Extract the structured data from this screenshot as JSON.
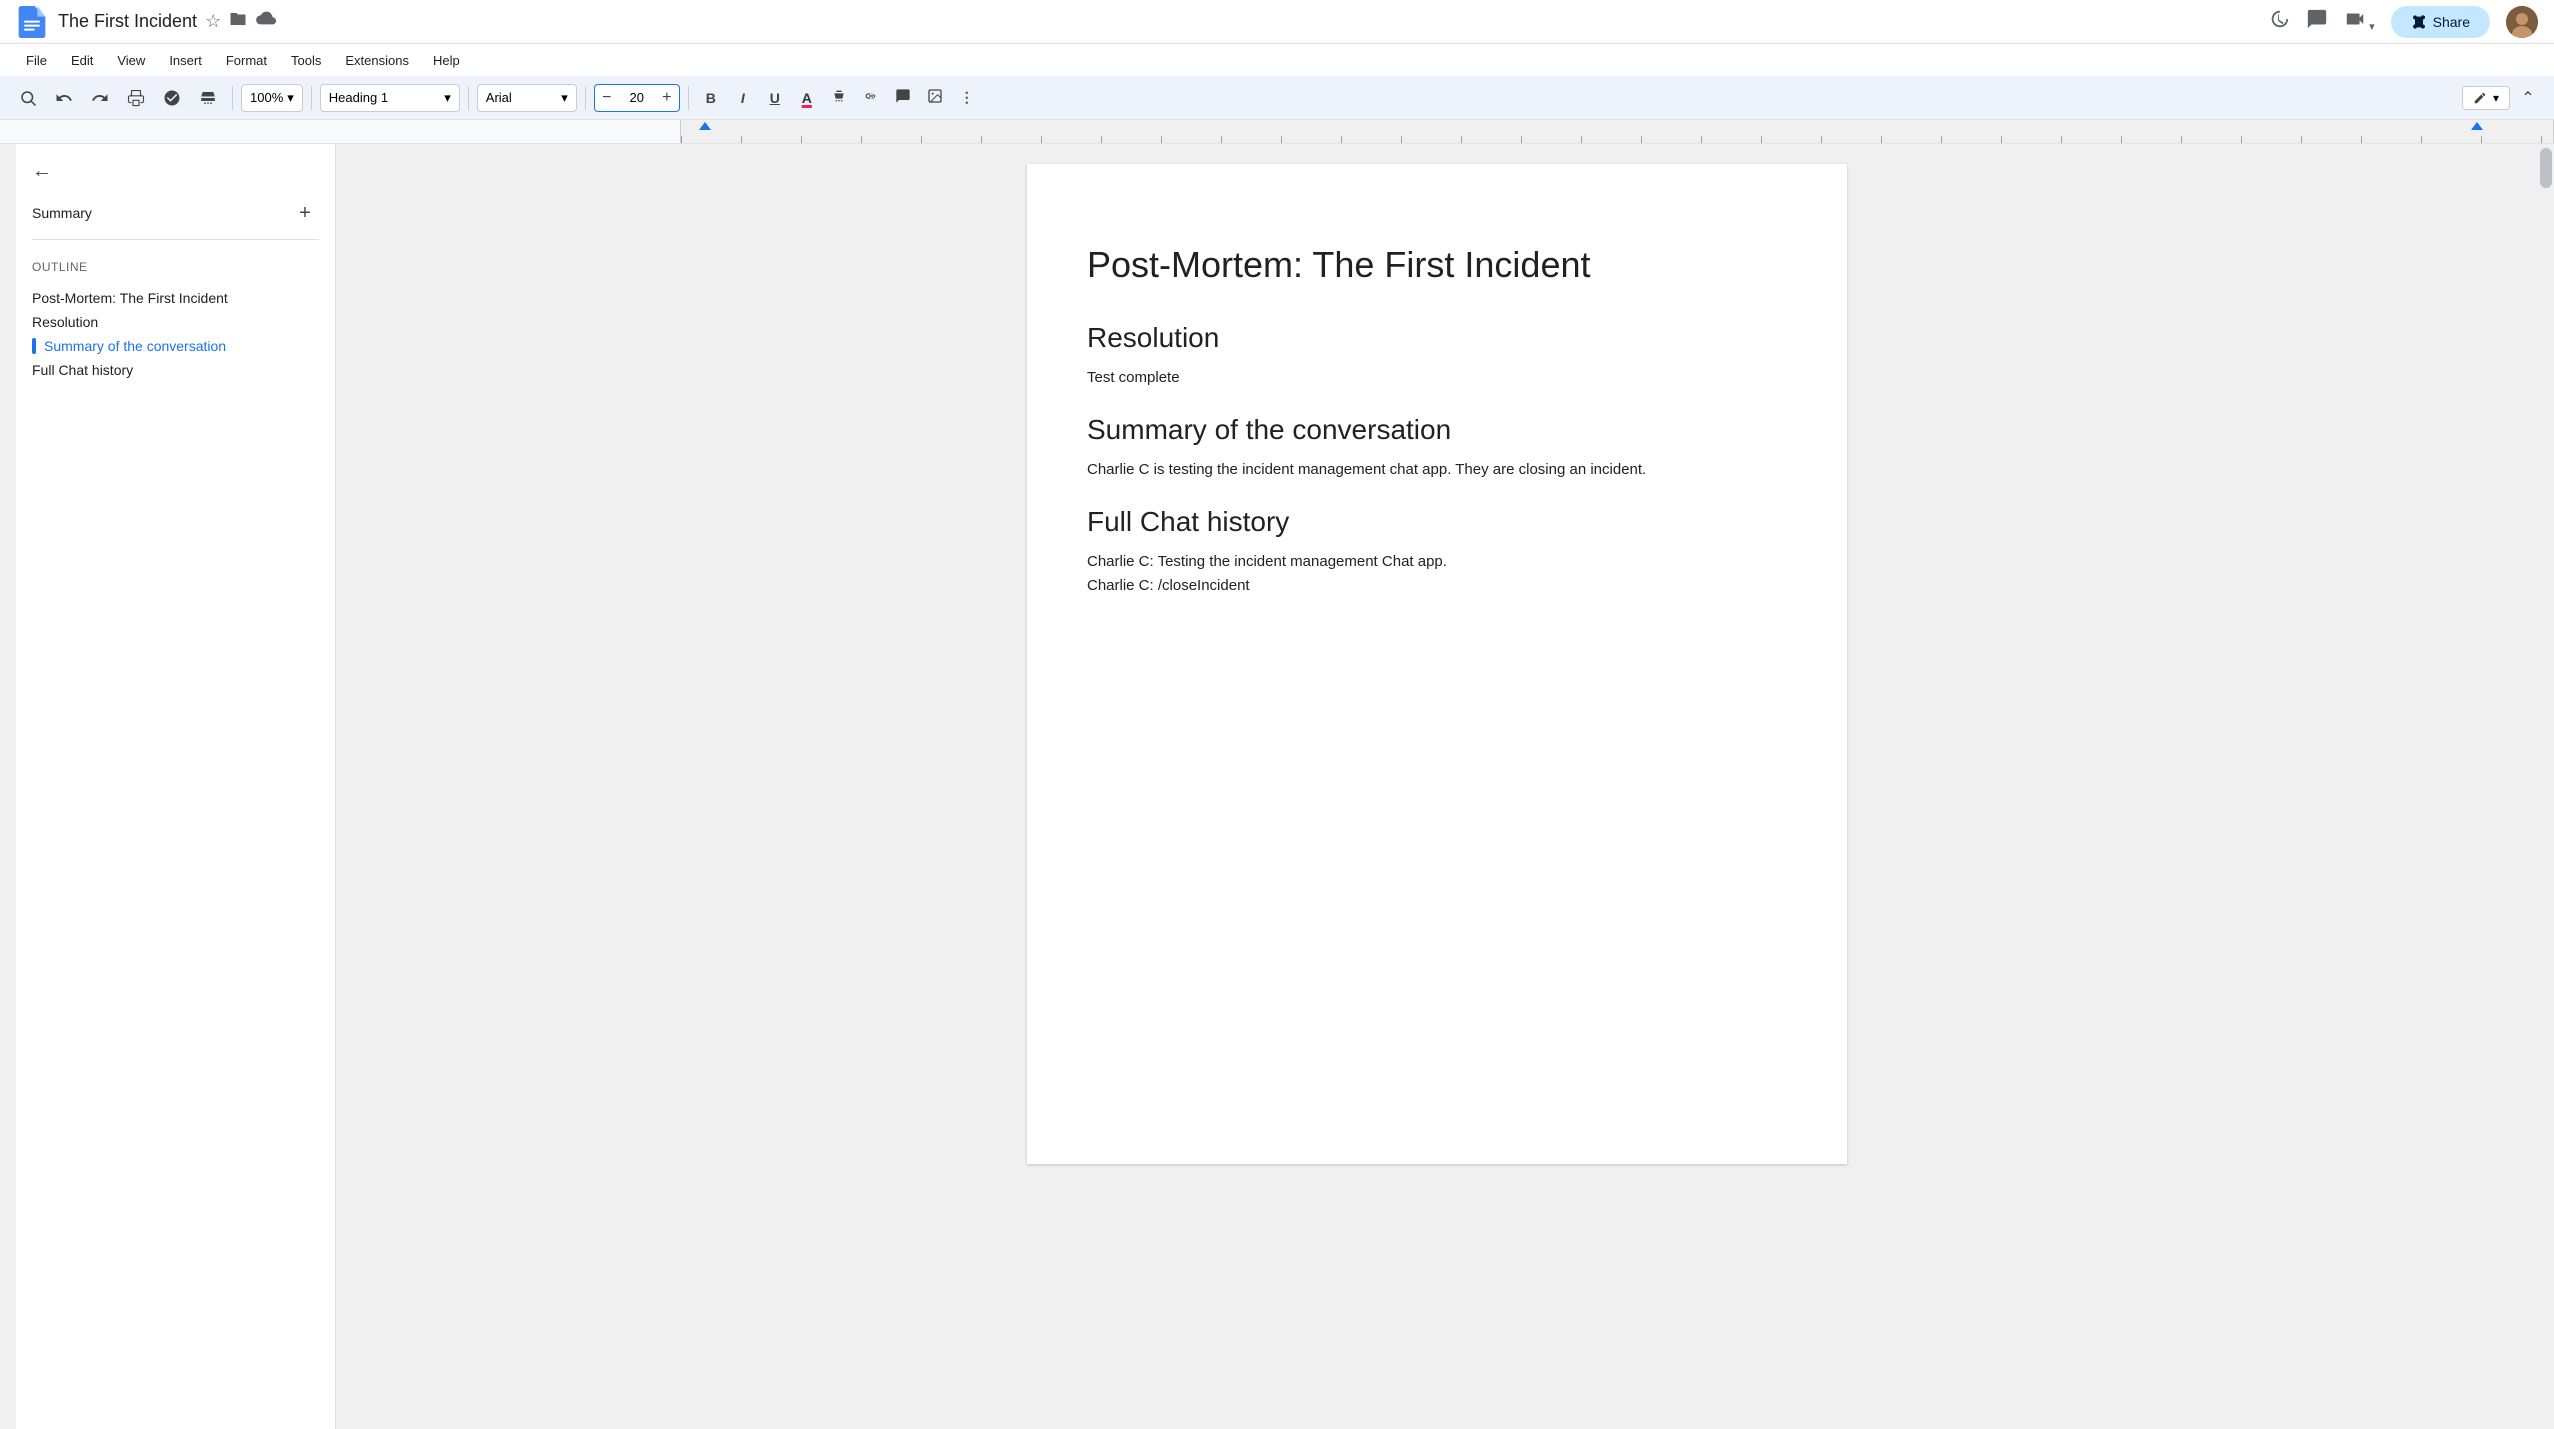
{
  "titlebar": {
    "doc_title": "The First Incident",
    "logo_alt": "Google Docs",
    "star_icon": "☆",
    "folder_icon": "📁",
    "cloud_icon": "☁",
    "history_icon": "🕐",
    "comment_icon": "💬",
    "video_icon": "📷",
    "share_label": "Share",
    "lock_icon": "🔒"
  },
  "menubar": {
    "items": [
      "File",
      "Edit",
      "View",
      "Insert",
      "Format",
      "Tools",
      "Extensions",
      "Help"
    ]
  },
  "toolbar": {
    "search_icon": "🔍",
    "undo_icon": "↩",
    "redo_icon": "↪",
    "print_icon": "🖨",
    "spellcheck_icon": "✓",
    "paintformat_icon": "🖌",
    "zoom_label": "100%",
    "zoom_dropdown": "▾",
    "style_label": "Heading 1",
    "style_dropdown": "▾",
    "font_label": "Arial",
    "font_dropdown": "▾",
    "font_size": "20",
    "font_minus": "−",
    "font_plus": "+",
    "bold": "B",
    "italic": "I",
    "underline": "U",
    "text_color": "A",
    "highlight": "✏",
    "link": "🔗",
    "comment": "💬",
    "image": "🖼",
    "more_icon": "⋮",
    "edit_mode_label": "✏",
    "collapse_icon": "⌃"
  },
  "sidebar": {
    "back_icon": "←",
    "summary_label": "Summary",
    "add_icon": "+",
    "outline_label": "Outline",
    "outline_items": [
      {
        "label": "Post-Mortem: The First Incident",
        "active": false
      },
      {
        "label": "Resolution",
        "active": false
      },
      {
        "label": "Summary of the conversation",
        "active": true
      },
      {
        "label": "Full Chat history",
        "active": false
      }
    ]
  },
  "document": {
    "title": "Post-Mortem: The First Incident",
    "sections": [
      {
        "heading": "Resolution",
        "paragraphs": [
          "Test complete"
        ]
      },
      {
        "heading": "Summary of the conversation",
        "paragraphs": [
          "Charlie C is testing the incident management chat app. They are closing an incident."
        ]
      },
      {
        "heading": "Full Chat history",
        "paragraphs": [
          "Charlie C: Testing the incident management Chat app.",
          "Charlie C: /closeIncident"
        ]
      }
    ]
  }
}
